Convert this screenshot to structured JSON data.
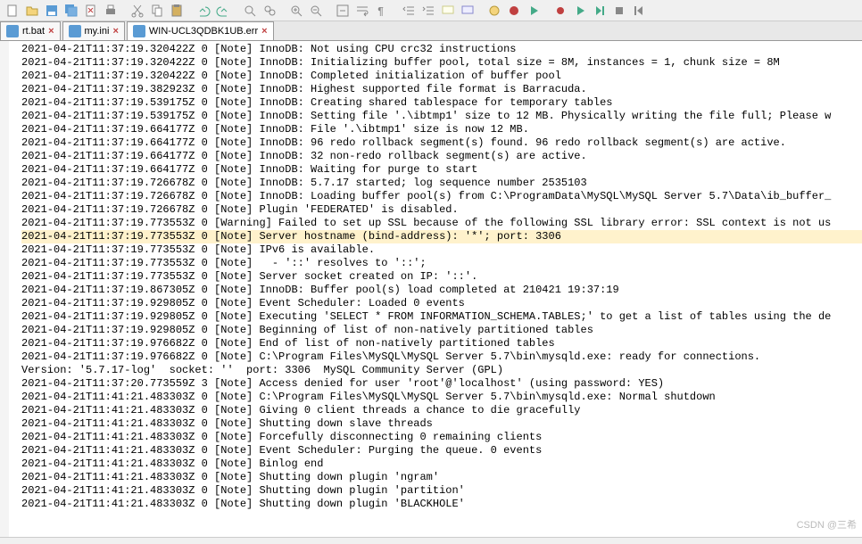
{
  "toolbar": {
    "icons": [
      "new-file-icon",
      "open-file-icon",
      "save-icon",
      "save-all-icon",
      "close-icon",
      "print-icon",
      "sep",
      "cut-icon",
      "copy-icon",
      "paste-icon",
      "sep",
      "undo-icon",
      "redo-icon",
      "sep",
      "find-icon",
      "find-all-icon",
      "sep",
      "zoom-in-icon",
      "zoom-out-icon",
      "sep",
      "toggle-fold-icon",
      "toggle-wrap-icon",
      "show-symbols-icon",
      "sep",
      "outdent-icon",
      "indent-icon",
      "comment-icon",
      "uncomment-icon",
      "sep",
      "macro-icon",
      "record-macro-icon",
      "run-macro-icon",
      "sep",
      "start-rec-icon",
      "play-icon",
      "step-icon",
      "stop-icon",
      "rewind-icon"
    ]
  },
  "tabs": [
    {
      "label": "rt.bat",
      "active": false,
      "close": "×"
    },
    {
      "label": "my.ini",
      "active": false,
      "close": "×"
    },
    {
      "label": "WIN-UCL3QDBK1UB.err",
      "active": true,
      "close": "×"
    }
  ],
  "highlightIndex": 14,
  "lines": [
    "2021-04-21T11:37:19.320422Z 0 [Note] InnoDB: Not using CPU crc32 instructions",
    "2021-04-21T11:37:19.320422Z 0 [Note] InnoDB: Initializing buffer pool, total size = 8M, instances = 1, chunk size = 8M",
    "2021-04-21T11:37:19.320422Z 0 [Note] InnoDB: Completed initialization of buffer pool",
    "2021-04-21T11:37:19.382923Z 0 [Note] InnoDB: Highest supported file format is Barracuda.",
    "2021-04-21T11:37:19.539175Z 0 [Note] InnoDB: Creating shared tablespace for temporary tables",
    "2021-04-21T11:37:19.539175Z 0 [Note] InnoDB: Setting file '.\\ibtmp1' size to 12 MB. Physically writing the file full; Please w",
    "2021-04-21T11:37:19.664177Z 0 [Note] InnoDB: File '.\\ibtmp1' size is now 12 MB.",
    "2021-04-21T11:37:19.664177Z 0 [Note] InnoDB: 96 redo rollback segment(s) found. 96 redo rollback segment(s) are active.",
    "2021-04-21T11:37:19.664177Z 0 [Note] InnoDB: 32 non-redo rollback segment(s) are active.",
    "2021-04-21T11:37:19.664177Z 0 [Note] InnoDB: Waiting for purge to start",
    "2021-04-21T11:37:19.726678Z 0 [Note] InnoDB: 5.7.17 started; log sequence number 2535103",
    "2021-04-21T11:37:19.726678Z 0 [Note] InnoDB: Loading buffer pool(s) from C:\\ProgramData\\MySQL\\MySQL Server 5.7\\Data\\ib_buffer_",
    "2021-04-21T11:37:19.726678Z 0 [Note] Plugin 'FEDERATED' is disabled.",
    "2021-04-21T11:37:19.773553Z 0 [Warning] Failed to set up SSL because of the following SSL library error: SSL context is not us",
    "2021-04-21T11:37:19.773553Z 0 [Note] Server hostname (bind-address): '*'; port: 3306",
    "2021-04-21T11:37:19.773553Z 0 [Note] IPv6 is available.",
    "2021-04-21T11:37:19.773553Z 0 [Note]   - '::' resolves to '::';",
    "2021-04-21T11:37:19.773553Z 0 [Note] Server socket created on IP: '::'.",
    "2021-04-21T11:37:19.867305Z 0 [Note] InnoDB: Buffer pool(s) load completed at 210421 19:37:19",
    "2021-04-21T11:37:19.929805Z 0 [Note] Event Scheduler: Loaded 0 events",
    "2021-04-21T11:37:19.929805Z 0 [Note] Executing 'SELECT * FROM INFORMATION_SCHEMA.TABLES;' to get a list of tables using the de",
    "2021-04-21T11:37:19.929805Z 0 [Note] Beginning of list of non-natively partitioned tables",
    "2021-04-21T11:37:19.976682Z 0 [Note] End of list of non-natively partitioned tables",
    "2021-04-21T11:37:19.976682Z 0 [Note] C:\\Program Files\\MySQL\\MySQL Server 5.7\\bin\\mysqld.exe: ready for connections.",
    "Version: '5.7.17-log'  socket: ''  port: 3306  MySQL Community Server (GPL)",
    "2021-04-21T11:37:20.773559Z 3 [Note] Access denied for user 'root'@'localhost' (using password: YES)",
    "2021-04-21T11:41:21.483303Z 0 [Note] C:\\Program Files\\MySQL\\MySQL Server 5.7\\bin\\mysqld.exe: Normal shutdown",
    "",
    "2021-04-21T11:41:21.483303Z 0 [Note] Giving 0 client threads a chance to die gracefully",
    "2021-04-21T11:41:21.483303Z 0 [Note] Shutting down slave threads",
    "2021-04-21T11:41:21.483303Z 0 [Note] Forcefully disconnecting 0 remaining clients",
    "2021-04-21T11:41:21.483303Z 0 [Note] Event Scheduler: Purging the queue. 0 events",
    "2021-04-21T11:41:21.483303Z 0 [Note] Binlog end",
    "2021-04-21T11:41:21.483303Z 0 [Note] Shutting down plugin 'ngram'",
    "2021-04-21T11:41:21.483303Z 0 [Note] Shutting down plugin 'partition'",
    "2021-04-21T11:41:21.483303Z 0 [Note] Shutting down plugin 'BLACKHOLE'"
  ],
  "watermark": "CSDN @三希"
}
